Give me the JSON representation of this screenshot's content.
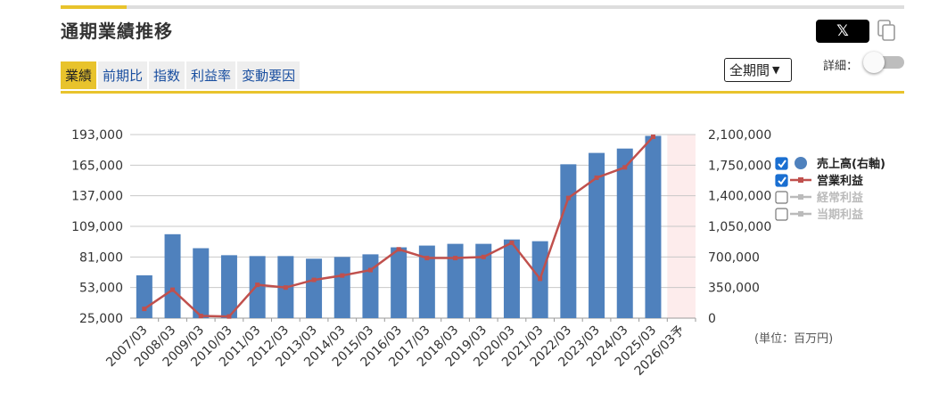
{
  "header": {
    "title": "通期業績推移",
    "x_button_label": "𝕏",
    "copy_icon": "copy-icon"
  },
  "tabs": [
    {
      "label": "業績",
      "active": true
    },
    {
      "label": "前期比",
      "active": false
    },
    {
      "label": "指数",
      "active": false
    },
    {
      "label": "利益率",
      "active": false
    },
    {
      "label": "変動要因",
      "active": false
    }
  ],
  "controls": {
    "period_select_value": "全期間",
    "detail_label": "詳細：",
    "detail_toggle_on": false
  },
  "unit_label": "(単位：百万円)",
  "colors": {
    "accent": "#e8c32c",
    "bar": "#4f81bd",
    "line": "#c0504d",
    "forecast_shade": "#fdecec",
    "disabled": "#bbbbbb"
  },
  "chart_data": {
    "type": "bar",
    "categories": [
      "2007/03",
      "2008/03",
      "2009/03",
      "2010/03",
      "2011/03",
      "2012/03",
      "2013/03",
      "2014/03",
      "2015/03",
      "2016/03",
      "2017/03",
      "2018/03",
      "2019/03",
      "2020/03",
      "2021/03",
      "2022/03",
      "2023/03",
      "2024/03",
      "2025/03",
      "2026/03予"
    ],
    "left_axis": {
      "ticks": [
        "193,000",
        "165,000",
        "137,000",
        "109,000",
        "81,000",
        "53,000",
        "25,000"
      ],
      "min": 25000,
      "max": 193000
    },
    "right_axis": {
      "ticks": [
        "2,100,000",
        "1,750,000",
        "1,400,000",
        "1,050,000",
        "700,000",
        "350,000",
        "0"
      ],
      "min": 0,
      "max": 2100000
    },
    "grid": true,
    "forecast_category": "2026/03予",
    "series": [
      {
        "name": "売上高(右軸)",
        "axis": "right",
        "kind": "bar",
        "checked": true,
        "values": [
          490000,
          960000,
          800000,
          720000,
          710000,
          710000,
          680000,
          700000,
          730000,
          810000,
          830000,
          850000,
          850000,
          900000,
          880000,
          1760000,
          1890000,
          1940000,
          2085000,
          null
        ]
      },
      {
        "name": "営業利益",
        "axis": "left",
        "kind": "line",
        "checked": true,
        "values": [
          33500,
          51000,
          27000,
          26500,
          55500,
          53000,
          60000,
          64000,
          69000,
          88000,
          80000,
          80000,
          81000,
          94000,
          61000,
          135000,
          153500,
          163000,
          191000,
          null
        ]
      },
      {
        "name": "経常利益",
        "axis": "left",
        "kind": "line",
        "checked": false,
        "values": []
      },
      {
        "name": "当期利益",
        "axis": "left",
        "kind": "line",
        "checked": false,
        "values": []
      }
    ],
    "legend_position": "right"
  }
}
